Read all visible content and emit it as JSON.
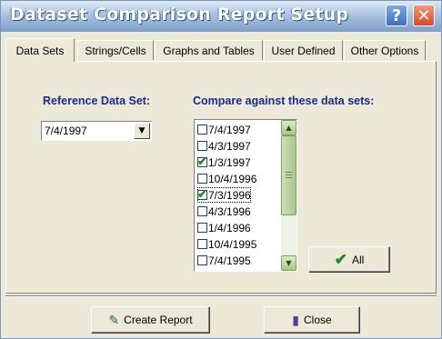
{
  "window": {
    "title": "Dataset Comparison Report Setup"
  },
  "titlebar": {
    "help_glyph": "?",
    "close_glyph": "✕"
  },
  "tabs": [
    {
      "label": "Data Sets",
      "active": true
    },
    {
      "label": "Strings/Cells",
      "active": false
    },
    {
      "label": "Graphs and Tables",
      "active": false
    },
    {
      "label": "User Defined",
      "active": false
    },
    {
      "label": "Other Options",
      "active": false
    }
  ],
  "reference": {
    "label": "Reference Data Set:",
    "selected": "7/4/1997"
  },
  "compare": {
    "label": "Compare against these data sets:",
    "items": [
      {
        "label": "7/4/1997",
        "checked": false
      },
      {
        "label": "4/3/1997",
        "checked": false
      },
      {
        "label": "1/3/1997",
        "checked": true
      },
      {
        "label": "10/4/1996",
        "checked": false
      },
      {
        "label": "7/3/1996",
        "checked": true
      },
      {
        "label": "4/3/1996",
        "checked": false
      },
      {
        "label": "1/4/1996",
        "checked": false
      },
      {
        "label": "10/4/1995",
        "checked": false
      },
      {
        "label": "7/4/1995",
        "checked": false
      }
    ],
    "focused_item": "7/3/1996",
    "all_button": "All"
  },
  "footer": {
    "create_report": "Create Report",
    "close": "Close"
  },
  "icons": {
    "dropdown": "chevron-down-icon",
    "scroll_up": "scroll-up-icon",
    "scroll_down": "scroll-down-icon",
    "all": "checkmark-icon",
    "create_report": "report-wizard-icon",
    "close": "door-exit-icon"
  },
  "colors": {
    "label_blue": "#1a2c8c",
    "check_green": "#1f8a2a",
    "close_red": "#d9492a"
  }
}
